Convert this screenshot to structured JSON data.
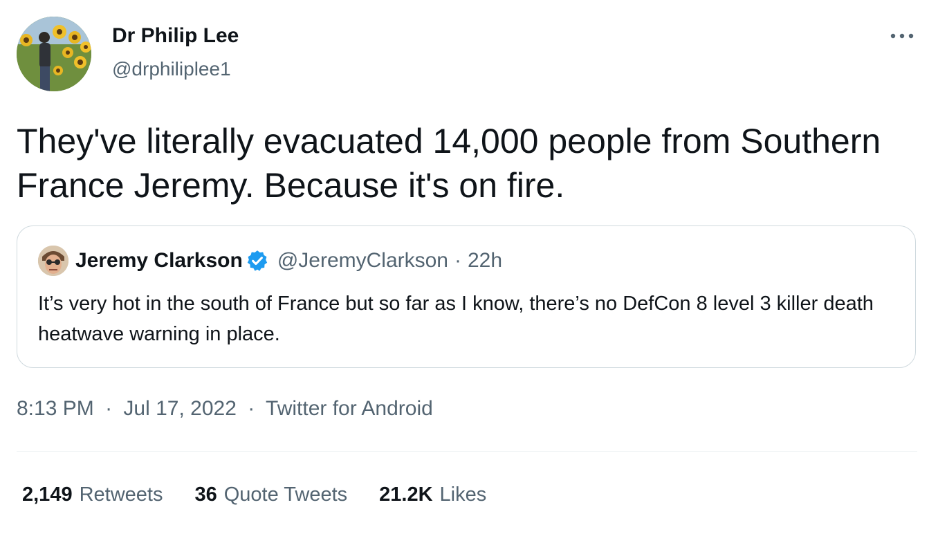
{
  "author": {
    "name": "Dr Philip Lee",
    "handle": "@drphiliplee1",
    "avatar_icon": "profile-photo-sunflowers"
  },
  "more_icon": "ellipsis-icon",
  "tweet": {
    "text": "They've literally evacuated 14,000 people from Southern France Jeremy. Because it's on fire."
  },
  "quoted_tweet": {
    "name": "Jeremy Clarkson",
    "verified": true,
    "handle": "@JeremyClarkson",
    "separator": "·",
    "time": "22h",
    "text": "It’s very hot in the south of France but so far as I know, there’s no DefCon 8 level 3 killer death heatwave warning in place.",
    "avatar_icon": "profile-photo"
  },
  "meta": {
    "time": "8:13 PM",
    "date": "Jul 17, 2022",
    "source": "Twitter for Android",
    "separator": "·"
  },
  "stats": [
    {
      "count": "2,149",
      "label": "Retweets"
    },
    {
      "count": "36",
      "label": "Quote Tweets"
    },
    {
      "count": "21.2K",
      "label": "Likes"
    }
  ],
  "colors": {
    "text": "#0f1419",
    "secondary": "#536471",
    "border": "#cfd9de",
    "verified_blue": "#1d9bf0"
  }
}
